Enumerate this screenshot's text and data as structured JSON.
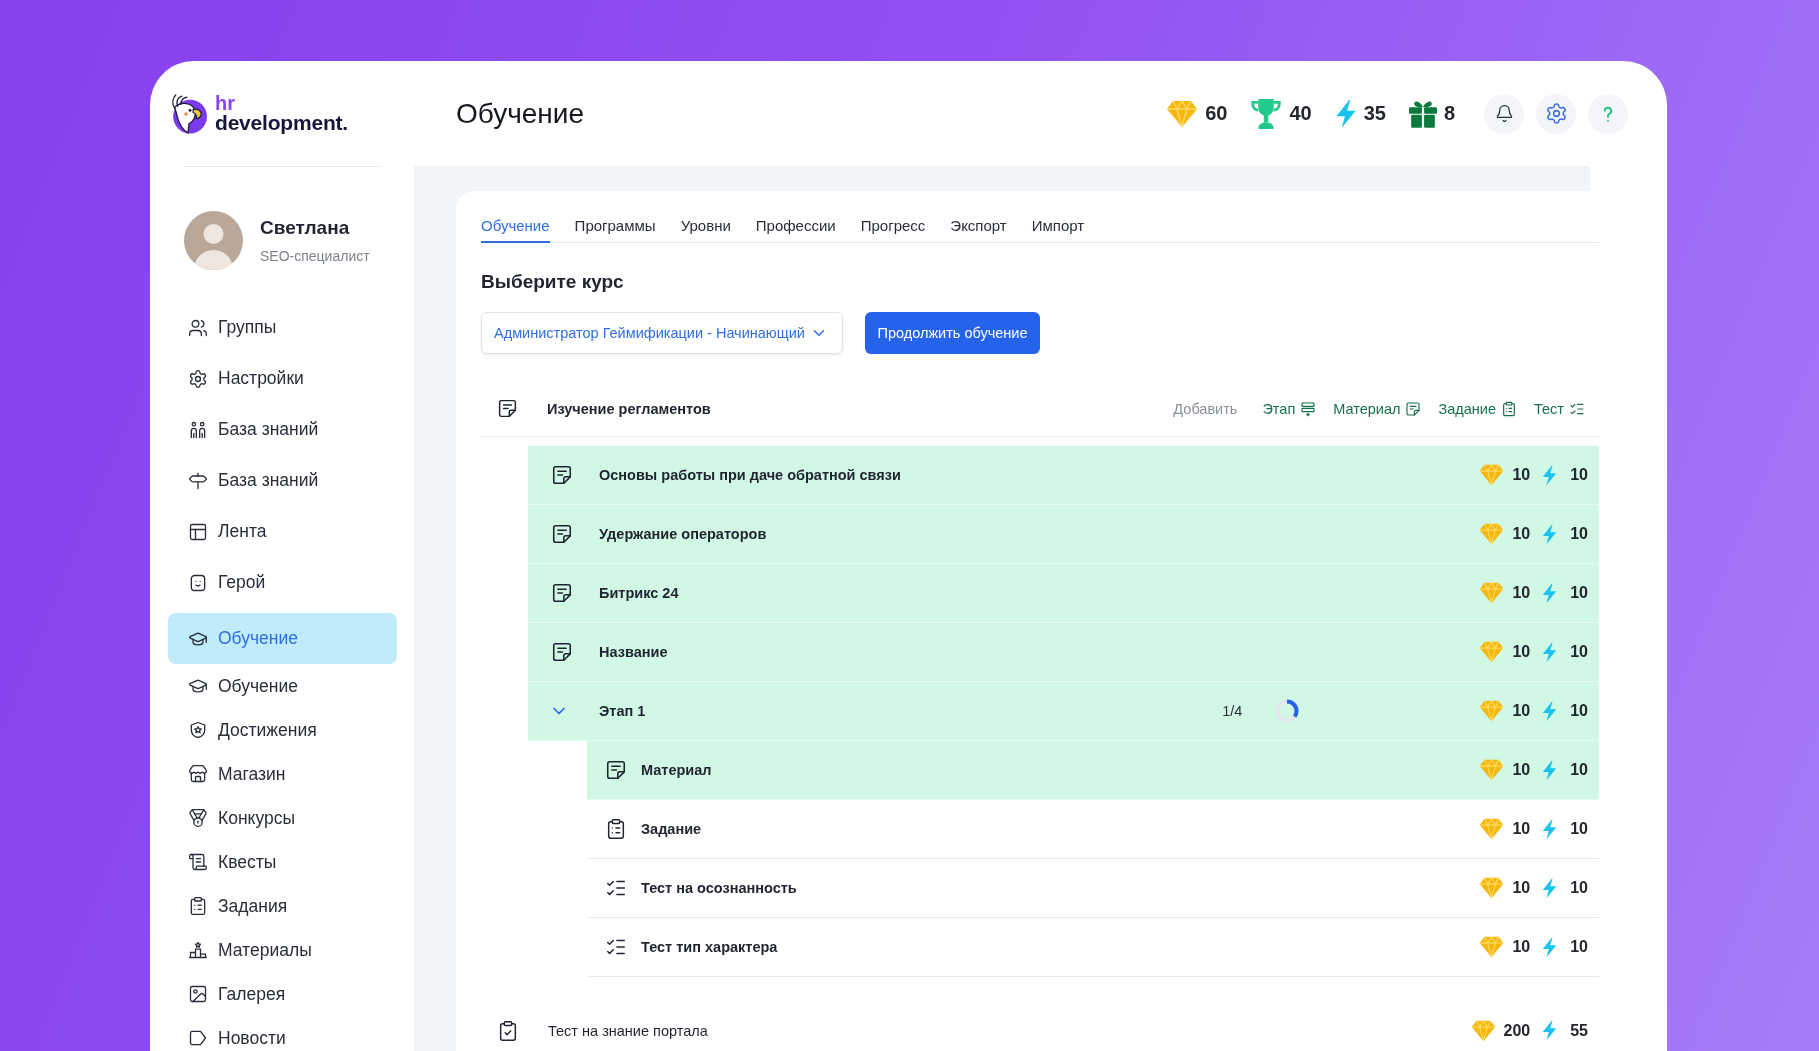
{
  "logo": {
    "top": "hr",
    "bottom": "development."
  },
  "header": {
    "title": "Обучение",
    "stats": [
      {
        "kind": "gems",
        "value": "60"
      },
      {
        "kind": "trophies",
        "value": "40"
      },
      {
        "kind": "energy",
        "value": "35"
      },
      {
        "kind": "gifts",
        "value": "8"
      }
    ]
  },
  "profile": {
    "name": "Светлана",
    "role": "SEO-специалист"
  },
  "nav": [
    {
      "items": [
        {
          "kind": "groups",
          "label": "Группы",
          "selected": false
        },
        {
          "kind": "settings",
          "label": "Настройки",
          "selected": false
        },
        {
          "kind": "people",
          "label": "База знаний",
          "selected": false
        },
        {
          "kind": "library",
          "label": "База знаний",
          "selected": false
        },
        {
          "kind": "feed",
          "label": "Лента",
          "selected": false
        },
        {
          "kind": "hero",
          "label": "Герой",
          "selected": false
        }
      ]
    },
    {
      "items": [
        {
          "kind": "learning",
          "label": "Обучение",
          "selected": true
        },
        {
          "kind": "learning",
          "label": "Обучение",
          "selected": false
        },
        {
          "kind": "achievements",
          "label": "Достижения",
          "selected": false
        },
        {
          "kind": "shop",
          "label": "Магазин",
          "selected": false
        },
        {
          "kind": "contests",
          "label": "Конкурсы",
          "selected": false
        },
        {
          "kind": "quests",
          "label": "Квесты",
          "selected": false
        },
        {
          "kind": "tasks",
          "label": "Задания",
          "selected": false
        },
        {
          "kind": "materials",
          "label": "Материалы",
          "selected": false
        },
        {
          "kind": "gallery",
          "label": "Галерея",
          "selected": false
        },
        {
          "kind": "news",
          "label": "Новости",
          "selected": false
        }
      ]
    }
  ],
  "tabs": [
    {
      "label": "Обучение",
      "selected": true
    },
    {
      "label": "Программы",
      "selected": false
    },
    {
      "label": "Уровни",
      "selected": false
    },
    {
      "label": "Профессии",
      "selected": false
    },
    {
      "label": "Прогресс",
      "selected": false
    },
    {
      "label": "Экспорт",
      "selected": false
    },
    {
      "label": "Импорт",
      "selected": false
    }
  ],
  "course": {
    "heading": "Выберите курс",
    "select": {
      "value": "Администратор Геймификации - Начинающий"
    },
    "button": "Продолжить обучение"
  },
  "modules": [
    {
      "kind": "block",
      "title": "Изучение регламентов",
      "toolbar": {
        "label": "Добавить",
        "actions": [
          {
            "kind": "stage",
            "label": "Этап"
          },
          {
            "kind": "material",
            "label": "Материал"
          },
          {
            "kind": "task",
            "label": "Задание"
          },
          {
            "kind": "test",
            "label": "Тест"
          }
        ]
      },
      "items": [
        {
          "kind": "material",
          "title": "Основы работы при даче обратной связи",
          "done": true,
          "gems": "10",
          "energy": "10"
        },
        {
          "kind": "material",
          "title": "Удержание операторов",
          "done": true,
          "gems": "10",
          "energy": "10"
        },
        {
          "kind": "material",
          "title": "Битрикс 24",
          "done": true,
          "gems": "10",
          "energy": "10"
        },
        {
          "kind": "material",
          "title": "Название",
          "done": true,
          "gems": "10",
          "energy": "10"
        },
        {
          "kind": "stage",
          "title": "Этап 1",
          "done": true,
          "expanded": true,
          "progress": "1/4",
          "level": 0.35,
          "gems": "10",
          "energy": "10",
          "children": [
            {
              "kind": "material",
              "title": "Материал",
              "done": true,
              "gems": "10",
              "energy": "10"
            },
            {
              "kind": "task",
              "title": "Задание",
              "done": false,
              "gems": "10",
              "energy": "10"
            },
            {
              "kind": "test",
              "title": "Тест на осознанность",
              "done": false,
              "gems": "10",
              "energy": "10"
            },
            {
              "kind": "test",
              "title": "Тест тип характера",
              "done": false,
              "gems": "10",
              "energy": "10"
            }
          ]
        }
      ]
    },
    {
      "kind": "test",
      "title": "Тест на знание портала",
      "gems": "200",
      "energy": "55"
    }
  ]
}
